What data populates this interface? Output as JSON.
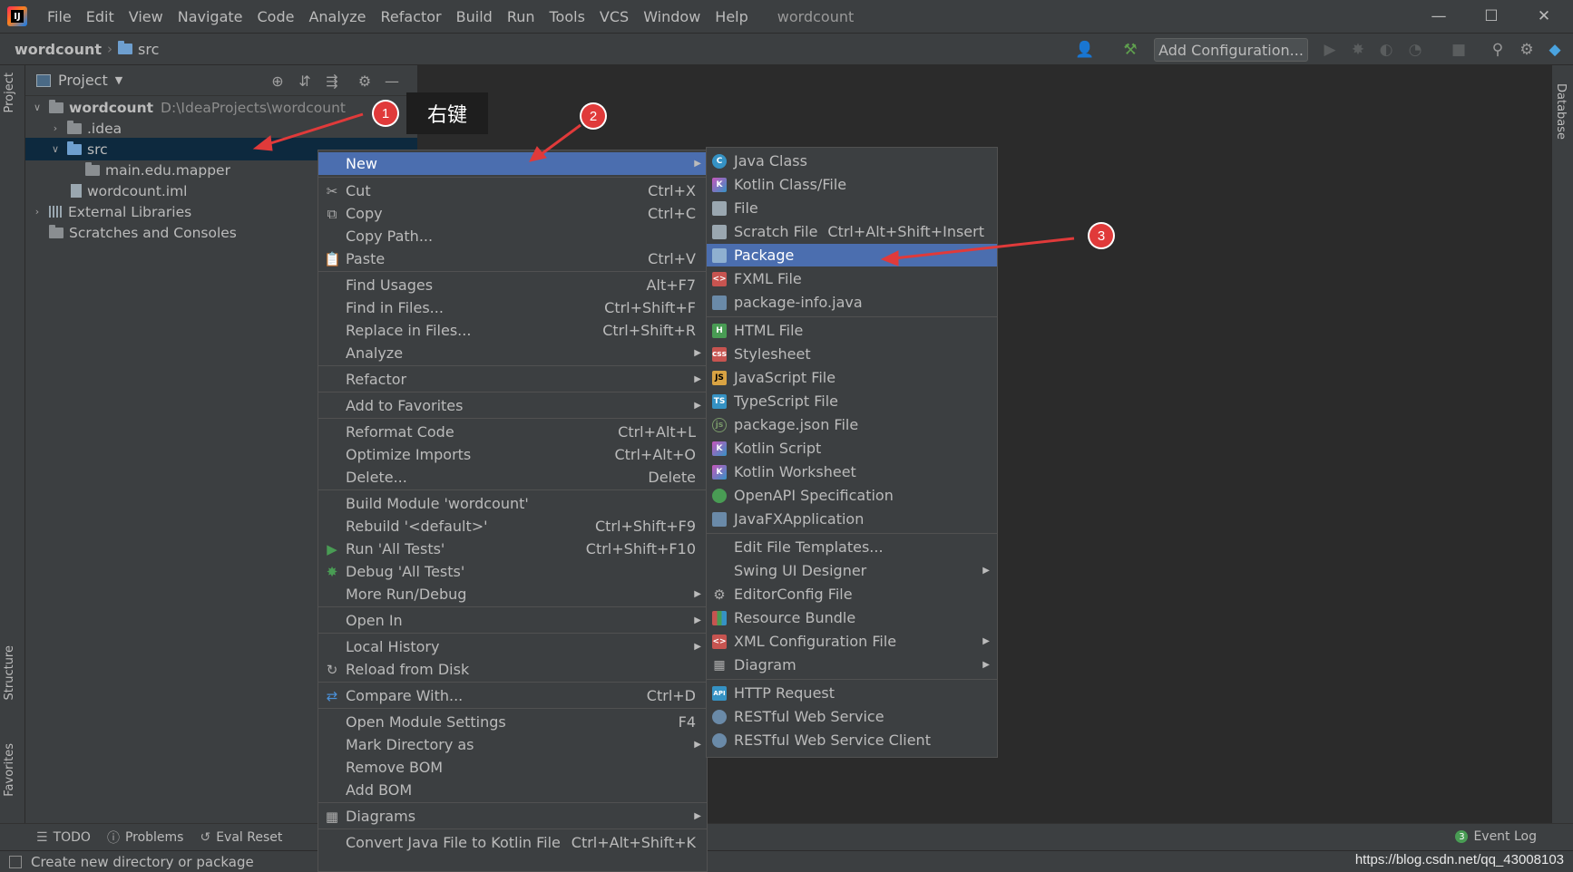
{
  "window": {
    "title": "wordcount",
    "menu": [
      "File",
      "Edit",
      "View",
      "Navigate",
      "Code",
      "Analyze",
      "Refactor",
      "Build",
      "Run",
      "Tools",
      "VCS",
      "Window",
      "Help"
    ]
  },
  "navbar": {
    "project": "wordcount",
    "folder": "src",
    "add_config": "Add Configuration..."
  },
  "sidebar": {
    "project_tab": "Project",
    "structure_tab": "Structure",
    "favorites_tab": "Favorites",
    "database_tab": "Database"
  },
  "project_panel": {
    "title": "Project",
    "tree": [
      {
        "label": "wordcount",
        "hint": "D:\\IdeaProjects\\wordcount"
      },
      {
        "label": ".idea"
      },
      {
        "label": "src"
      },
      {
        "label": "main.edu.mapper"
      },
      {
        "label": "wordcount.iml"
      },
      {
        "label": "External Libraries"
      },
      {
        "label": "Scratches and Consoles"
      }
    ]
  },
  "context_menu": {
    "items": [
      {
        "label": "New",
        "shortcut": ""
      },
      {
        "label": "Cut",
        "shortcut": "Ctrl+X"
      },
      {
        "label": "Copy",
        "shortcut": "Ctrl+C"
      },
      {
        "label": "Copy Path...",
        "shortcut": ""
      },
      {
        "label": "Paste",
        "shortcut": "Ctrl+V"
      },
      {
        "label": "Find Usages",
        "shortcut": "Alt+F7"
      },
      {
        "label": "Find in Files...",
        "shortcut": "Ctrl+Shift+F"
      },
      {
        "label": "Replace in Files...",
        "shortcut": "Ctrl+Shift+R"
      },
      {
        "label": "Analyze",
        "shortcut": ""
      },
      {
        "label": "Refactor",
        "shortcut": ""
      },
      {
        "label": "Add to Favorites",
        "shortcut": ""
      },
      {
        "label": "Reformat Code",
        "shortcut": "Ctrl+Alt+L"
      },
      {
        "label": "Optimize Imports",
        "shortcut": "Ctrl+Alt+O"
      },
      {
        "label": "Delete...",
        "shortcut": "Delete"
      },
      {
        "label": "Build Module 'wordcount'",
        "shortcut": ""
      },
      {
        "label": "Rebuild '<default>'",
        "shortcut": "Ctrl+Shift+F9"
      },
      {
        "label": "Run 'All Tests'",
        "shortcut": "Ctrl+Shift+F10"
      },
      {
        "label": "Debug 'All Tests'",
        "shortcut": ""
      },
      {
        "label": "More Run/Debug",
        "shortcut": ""
      },
      {
        "label": "Open In",
        "shortcut": ""
      },
      {
        "label": "Local History",
        "shortcut": ""
      },
      {
        "label": "Reload from Disk",
        "shortcut": ""
      },
      {
        "label": "Compare With...",
        "shortcut": "Ctrl+D"
      },
      {
        "label": "Open Module Settings",
        "shortcut": "F4"
      },
      {
        "label": "Mark Directory as",
        "shortcut": ""
      },
      {
        "label": "Remove BOM",
        "shortcut": ""
      },
      {
        "label": "Add BOM",
        "shortcut": ""
      },
      {
        "label": "Diagrams",
        "shortcut": ""
      },
      {
        "label": "Convert Java File to Kotlin File",
        "shortcut": "Ctrl+Alt+Shift+K"
      }
    ]
  },
  "new_submenu": {
    "items": [
      {
        "label": "Java Class",
        "icon": "java-class-icon"
      },
      {
        "label": "Kotlin Class/File",
        "icon": "kotlin-icon"
      },
      {
        "label": "File",
        "icon": "file-icon"
      },
      {
        "label": "Scratch File",
        "shortcut": "Ctrl+Alt+Shift+Insert",
        "icon": "scratch-file-icon"
      },
      {
        "label": "Package",
        "icon": "package-icon"
      },
      {
        "label": "FXML File",
        "icon": "fxml-icon"
      },
      {
        "label": "package-info.java",
        "icon": "java-file-icon"
      },
      {
        "label": "HTML File",
        "icon": "html-icon"
      },
      {
        "label": "Stylesheet",
        "icon": "css-icon"
      },
      {
        "label": "JavaScript File",
        "icon": "js-icon"
      },
      {
        "label": "TypeScript File",
        "icon": "ts-icon"
      },
      {
        "label": "package.json File",
        "icon": "npm-icon"
      },
      {
        "label": "Kotlin Script",
        "icon": "kotlin-script-icon"
      },
      {
        "label": "Kotlin Worksheet",
        "icon": "kotlin-worksheet-icon"
      },
      {
        "label": "OpenAPI Specification",
        "icon": "openapi-icon"
      },
      {
        "label": "JavaFXApplication",
        "icon": "javafx-icon"
      },
      {
        "label": "Edit File Templates...",
        "icon": ""
      },
      {
        "label": "Swing UI Designer",
        "icon": ""
      },
      {
        "label": "EditorConfig File",
        "icon": "gear-icon"
      },
      {
        "label": "Resource Bundle",
        "icon": "resource-bundle-icon"
      },
      {
        "label": "XML Configuration File",
        "icon": "xml-icon"
      },
      {
        "label": "Diagram",
        "icon": "diagram-icon"
      },
      {
        "label": "HTTP Request",
        "icon": "api-icon"
      },
      {
        "label": "RESTful Web Service",
        "icon": "globe-icon"
      },
      {
        "label": "RESTful Web Service Client",
        "icon": "globe-client-icon"
      }
    ]
  },
  "bottom_tools": [
    "TODO",
    "Problems",
    "Eval Reset"
  ],
  "event_log": {
    "count": "3",
    "label": "Event Log"
  },
  "status": {
    "text": "Create new directory or package"
  },
  "watermark": "https://blog.csdn.net/qq_43008103",
  "annotations": {
    "step1": "1",
    "step2": "2",
    "step3": "3",
    "note": "右键"
  },
  "colors": {
    "highlight": "#4b6eaf",
    "annotation": "#e03a3a",
    "background": "#2b2b2b",
    "panel": "#3c3f41"
  }
}
